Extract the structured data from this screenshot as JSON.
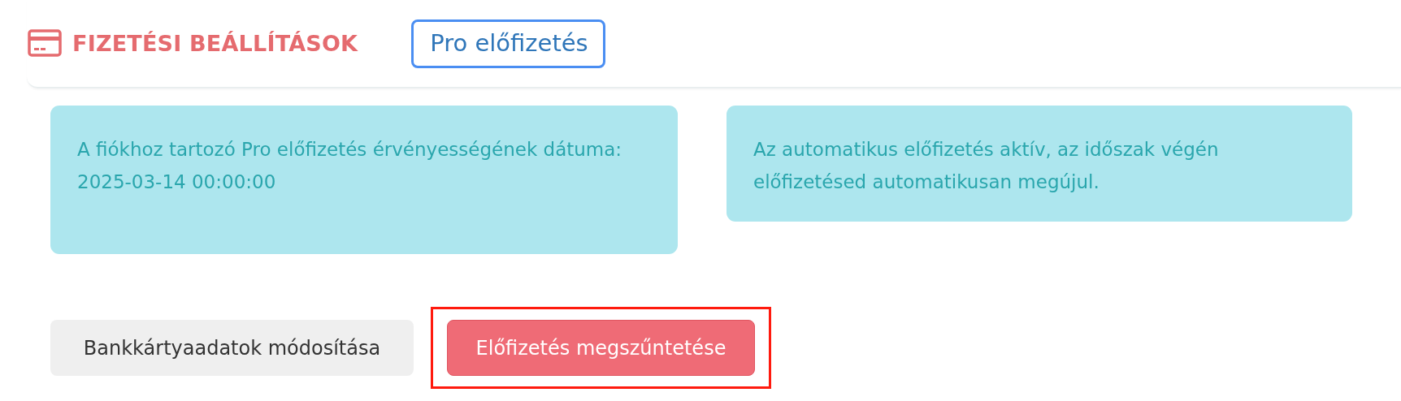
{
  "header": {
    "title": "FIZETÉSI BEÁLLÍTÁSOK",
    "badge": "Pro előfizetés"
  },
  "notices": [
    {
      "text": "A fiókhoz tartozó Pro előfizetés érvényességének dátuma:",
      "date": "2025-03-14 00:00:00"
    },
    {
      "text": "Az automatikus előfizetés aktív, az időszak végén előfizetésed automatikusan megújul."
    }
  ],
  "buttons": [
    {
      "label": "Bankkártyaadatok módosítása",
      "kind": "secondary",
      "highlighted": false
    },
    {
      "label": "Előfizetés megszűntetése",
      "kind": "danger",
      "highlighted": true
    }
  ]
}
